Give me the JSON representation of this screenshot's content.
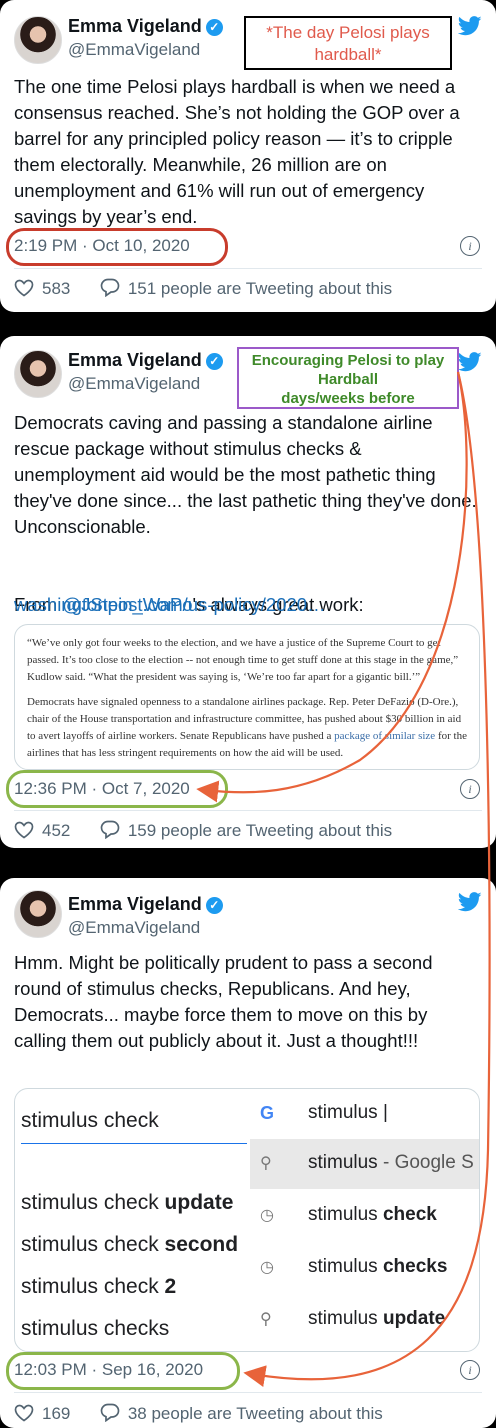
{
  "tweets": [
    {
      "name": "Emma Vigeland",
      "handle": "@EmmaVigeland",
      "text": "The one time Pelosi plays hardball is when we need a consensus reached. She’s not holding the GOP over a barrel for any principled policy reason — it’s to cripple them electorally. Meanwhile, 26 million are on unemployment and 61% will run out of emergency savings by year’s end.",
      "time": "2:19 PM · Oct 10, 2020",
      "likes": "583",
      "retweeting": "151 people are Tweeting about this"
    },
    {
      "name": "Emma Vigeland",
      "handle": "@EmmaVigeland",
      "text": "Democrats caving and passing a standalone airline rescue package without stimulus checks & unemployment aid would be the most pathetic thing they've done since... the last pathetic thing they've done. Unconscionable.",
      "from_prefix": "From ",
      "mention": "@JStein_WaPo",
      "from_suffix": "'s always great work:",
      "url": "washingtonpost.com/us-policy/2020…",
      "quote_p1": "“We’ve only got four weeks to the election, and we have a justice of the Supreme Court to get passed. It’s too close to the election -- not enough time to get stuff done at this stage in the game,” Kudlow said. “What the president was saying is, ‘We’re too far apart for a gigantic bill.’”",
      "quote_p2_a": "Democrats have signaled openness to a standalone airlines package. Rep. Peter DeFazio (D-Ore.), chair of the House transportation and infrastructure committee, has pushed about $30 billion in aid to avert layoffs of airline workers. Senate Republicans have pushed a ",
      "quote_p2_link": "package of similar size",
      "quote_p2_b": " for the airlines that has less stringent requirements on how the aid will be used.",
      "time": "12:36 PM · Oct 7, 2020",
      "likes": "452",
      "retweeting": "159 people are Tweeting about this"
    },
    {
      "name": "Emma Vigeland",
      "handle": "@EmmaVigeland",
      "text": "Hmm. Might be politically prudent to pass a second round of stimulus checks, Republicans. And hey, Democrats... maybe force them to move on this by calling them out publicly about it. Just a thought!!!",
      "time": "12:03 PM · Sep 16, 2020",
      "likes": "169",
      "retweeting": "38 people are Tweeting about this"
    }
  ],
  "search_image": {
    "left_input": "stimulus check",
    "left_options": [
      {
        "base": "stimulus check ",
        "bold": "update"
      },
      {
        "base": "stimulus check ",
        "bold": "second"
      },
      {
        "base": "stimulus check ",
        "bold": "2"
      },
      {
        "base": "stimulus check",
        "bold": "s"
      }
    ],
    "right_input": "stimulus",
    "right_rows": [
      {
        "icon": "search-icon",
        "base": "stimulus",
        "suffix": " - Google S",
        "bold": ""
      },
      {
        "icon": "history-icon",
        "base": "stimulus ",
        "suffix": "",
        "bold": "check"
      },
      {
        "icon": "history-icon",
        "base": "stimulus ",
        "suffix": "",
        "bold": "checks"
      },
      {
        "icon": "search-icon",
        "base": "stimulus ",
        "suffix": "",
        "bold": "update"
      }
    ]
  },
  "annotations": {
    "top_note_line1": "*The day Pelosi plays",
    "top_note_line2": "hardball*",
    "middle_note_line1": "Encouraging Pelosi to play",
    "middle_note_line2": "Hardball",
    "middle_note_line3": "days/weeks before"
  },
  "colors": {
    "red_annotation": "#e05a4c",
    "green_annotation": "#8bb64a",
    "purple_box": "#9b59c9",
    "arrow": "#e8633a",
    "twitter_blue": "#1d9bf0"
  }
}
